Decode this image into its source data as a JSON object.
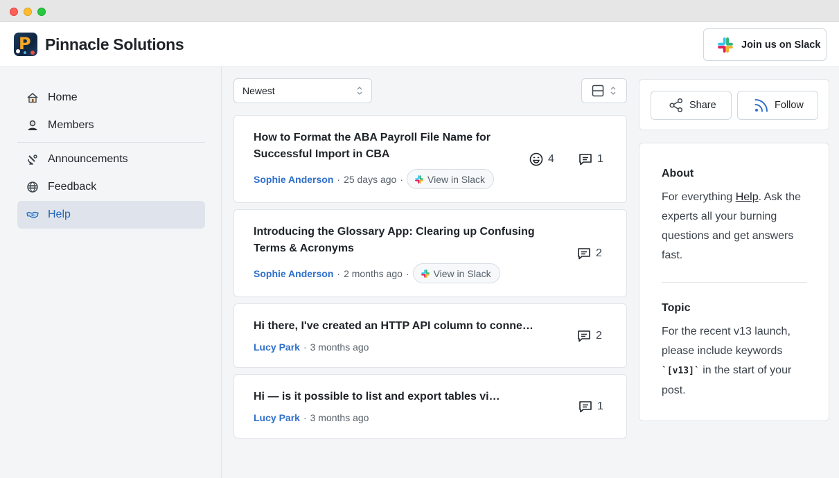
{
  "header": {
    "brand": "Pinnacle Solutions",
    "slack_button": "Join us on Slack"
  },
  "sidebar": {
    "items": [
      {
        "label": "Home",
        "icon": "house-icon"
      },
      {
        "label": "Members",
        "icon": "user-icon"
      },
      {
        "label": "Announcements",
        "icon": "satellite-icon"
      },
      {
        "label": "Feedback",
        "icon": "globe-icon"
      },
      {
        "label": "Help",
        "icon": "handshake-icon",
        "active": true
      }
    ]
  },
  "toolbar": {
    "sort_value": "Newest"
  },
  "posts": [
    {
      "title": "How to Format the ABA Payroll File Name for Successful Import in CBA",
      "author": "Sophie Anderson",
      "time": "25 days ago",
      "slack_link": "View in Slack",
      "reactions": "4",
      "comments": "1"
    },
    {
      "title": "Introducing the Glossary App: Clearing up Confusing Terms & Acronyms",
      "author": "Sophie Anderson",
      "time": "2 months ago",
      "slack_link": "View in Slack",
      "comments": "2"
    },
    {
      "title": "Hi there, I've created an HTTP API column to connect it to an external system",
      "author": "Lucy Park",
      "time": "3 months ago",
      "comments": "2"
    },
    {
      "title": "Hi — is it possible to list and export tables via API?",
      "author": "Lucy Park",
      "time": "3 months ago",
      "comments": "1"
    }
  ],
  "actions": {
    "share": "Share",
    "follow": "Follow"
  },
  "about": {
    "heading": "About",
    "text_before": "For everything ",
    "link": "Help",
    "text_after": ". Ask the experts all your burning questions and get answers fast.",
    "topic_heading": "Topic",
    "topic_before": "For the recent v13 launch, please include keywords ",
    "topic_code": "`[v13]`",
    "topic_after": " in the start of your post."
  },
  "colors": {
    "accent": "#2f6fca",
    "active_nav_bg": "#dfe4ec",
    "page_bg": "#f4f5f7"
  }
}
